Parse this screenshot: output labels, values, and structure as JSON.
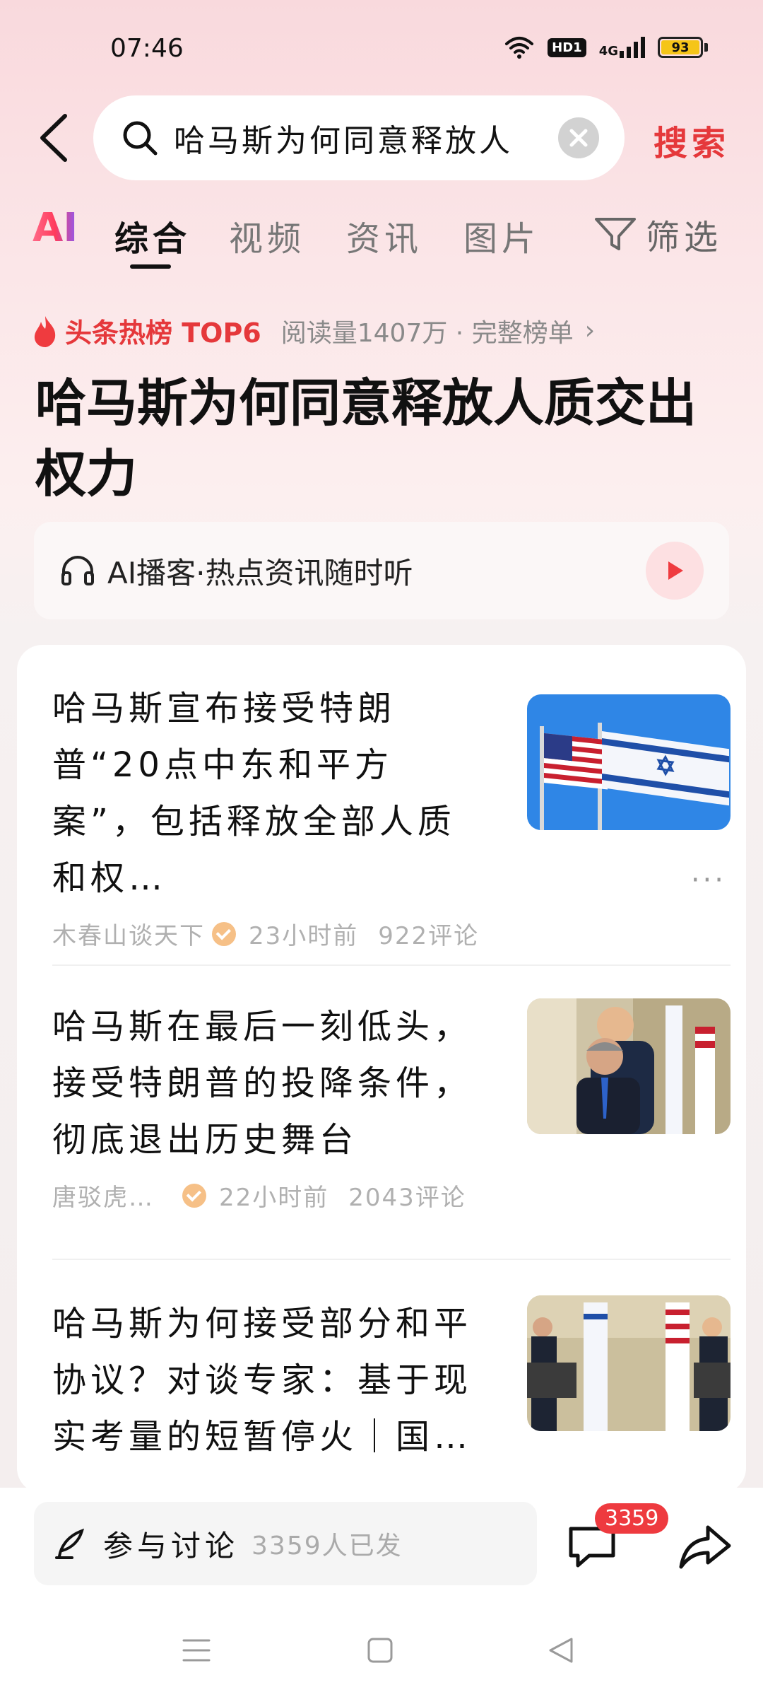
{
  "status_bar": {
    "time": "07:46",
    "hd_label": "HD1",
    "network_label": "4G",
    "battery_level": "93",
    "battery_color": "#f5c518"
  },
  "search": {
    "query": "哈马斯为何同意释放人",
    "submit_label": "搜索"
  },
  "tabs": {
    "ai_label": "AI",
    "items": [
      "综合",
      "视频",
      "资讯",
      "图片"
    ],
    "active_index": 0,
    "filter_label": "筛选"
  },
  "hot": {
    "title": "头条热榜 TOP6",
    "meta": "阅读量1407万 · 完整榜单",
    "headline": "哈马斯为何同意释放人质交出权力"
  },
  "podcast": {
    "label": "AI播客·热点资讯随时听"
  },
  "news": [
    {
      "title": "哈马斯宣布接受特朗普“20点中东和平方案”，包括释放全部人质和权…",
      "source": "木春山谈天下",
      "time": "23小时前",
      "comments": "922评论",
      "more_label": "···"
    },
    {
      "title": "哈马斯在最后一刻低头，接受特朗普的投降条件，彻底退出历史舞台",
      "source": "唐驳虎…",
      "time": "22小时前",
      "comments": "2043评论"
    },
    {
      "title": "哈马斯为何接受部分和平协议？对谈专家：基于现实考量的短暂停火｜国…"
    }
  ],
  "bottom": {
    "comment_label": "参与讨论",
    "comment_count": "3359人已发",
    "message_badge": "3359"
  },
  "colors": {
    "accent": "#e5383b",
    "badge": "#ee3a3f"
  }
}
